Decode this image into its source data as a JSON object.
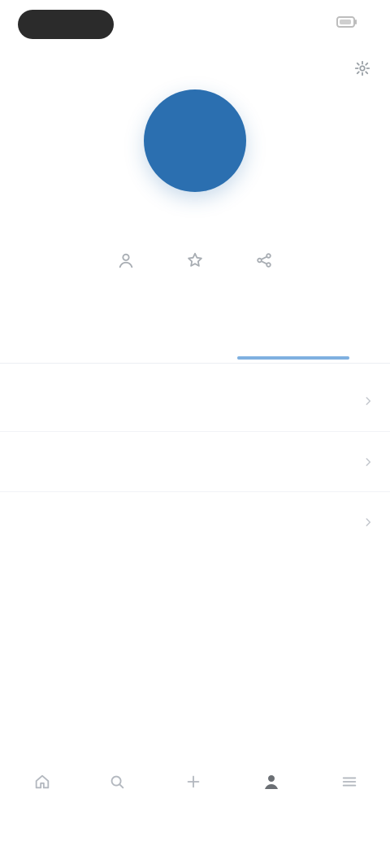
{
  "status_bar": {
    "time": "",
    "battery": ""
  },
  "header": {
    "settings_icon": "gear-icon"
  },
  "profile": {
    "avatar_text": "",
    "username": ""
  },
  "actions": [
    {
      "label": "",
      "icon": "user-icon"
    },
    {
      "label": "",
      "icon": "star-icon"
    },
    {
      "label": "",
      "icon": "share-icon"
    }
  ],
  "tabs": [
    {
      "label": "",
      "active": false
    },
    {
      "label": "",
      "active": false
    },
    {
      "label": "",
      "active": true
    }
  ],
  "list": [
    {
      "label": ""
    },
    {
      "label": ""
    },
    {
      "label": ""
    }
  ],
  "bottom_nav": [
    {
      "label": "",
      "icon": "home-icon"
    },
    {
      "label": "",
      "icon": "search-icon"
    },
    {
      "label": "",
      "icon": "plus-icon"
    },
    {
      "label": "",
      "icon": "profile-icon",
      "active": true
    },
    {
      "label": "",
      "icon": "menu-icon"
    }
  ],
  "colors": {
    "accent": "#2b6fb0",
    "tab_underline": "#7fb0e0"
  }
}
